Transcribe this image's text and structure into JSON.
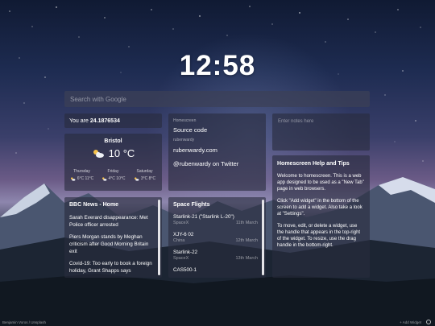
{
  "clock": {
    "time": "12:58"
  },
  "search": {
    "placeholder": "Search with Google"
  },
  "age": {
    "prefix": "You are",
    "value": "24.1876534"
  },
  "weather": {
    "city": "Bristol",
    "current_temp": "10 °C",
    "icon": "cloud-sun-icon",
    "forecast": [
      {
        "day": "Thursday",
        "temps": "6°C 11°C"
      },
      {
        "day": "Friday",
        "temps": "4°C 10°C"
      },
      {
        "day": "Saturday",
        "temps": "3°C 8°C"
      }
    ]
  },
  "links": {
    "title": "Homescreen",
    "items": [
      {
        "label": "Source code",
        "sub": "rubenwardy"
      },
      {
        "label": "rubenwardy.com",
        "sub": ""
      },
      {
        "label": "@rubenwardy on Twitter",
        "sub": ""
      }
    ]
  },
  "note": {
    "placeholder": "Enter notes here"
  },
  "help": {
    "title": "Homescreen Help and Tips",
    "paragraphs": [
      "Welcome to homescreen. This is a web app designed to be used as a \"New Tab\" page in web browsers.",
      "Click \"Add widget\" in the bottom of the screen to add a widget. Also take a look at \"Settings\".",
      "To move, edit, or delete a widget, use the handle that appears in the top-right of the widget. To resize, use the drag handle in the bottom-right."
    ]
  },
  "bbc": {
    "title": "BBC News - Home",
    "items": [
      "Sarah Everard disappearance: Met Police officer arrested",
      "Piers Morgan stands by Meghan criticism after Good Morning Britain exit",
      "Covid-19: Too early to book a foreign holiday, Grant Shapps says"
    ]
  },
  "space": {
    "title": "Space Flights",
    "items": [
      {
        "name": "Starlink-21 (\"Starlink L-20\")",
        "org": "SpaceX",
        "date": "11th March"
      },
      {
        "name": "XJY-6 02",
        "org": "China",
        "date": "12th March"
      },
      {
        "name": "Starlink-22",
        "org": "SpaceX",
        "date": "13th March"
      },
      {
        "name": "CAS500-1",
        "org": "",
        "date": ""
      }
    ]
  },
  "footer": {
    "credit": "Benjamin Voros / Unsplash",
    "add_widget": "+ Add Widget"
  }
}
